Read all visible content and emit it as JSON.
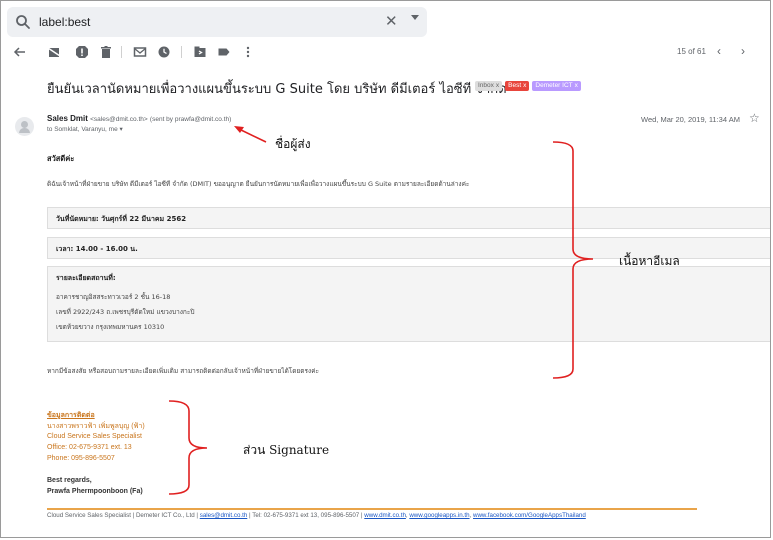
{
  "search": {
    "query": "label:best"
  },
  "toolbar": {
    "count": "15 of 61"
  },
  "email": {
    "subject": "ยืนยันเวลานัดหมายเพื่อวางแผนขึ้นระบบ G Suite โดย บริษัท ดีมีเตอร์ ไอซีที จำกัด",
    "labels": [
      {
        "text": "Inbox",
        "bg": "#dddddd",
        "fg": "#666666"
      },
      {
        "text": "Best",
        "bg": "#e8453c",
        "fg": "#ffffff"
      },
      {
        "text": "Demeter ICT",
        "bg": "#b99aff",
        "fg": "#ffffff"
      }
    ],
    "sender_name": "Sales Dmit",
    "sender_email": "<sales@dmit.co.th>",
    "sent_by": "(sent by prawfa@dmit.co.th)",
    "to": "to Somklat, Varanyu, me",
    "date": "Wed, Mar 20, 2019, 11:34 AM",
    "greeting": "สวัสดีค่ะ",
    "intro": "ดิฉันเจ้าหน้าที่ฝ่ายขาย บริษัท ดีมีเตอร์ ไอซีที จำกัด (DMIT) ขออนุญาต ยืนยันการนัดหมายเพื่อเพื่อวางแผนขึ้นระบบ G Suite ตามรายละเอียดด้านล่างค่ะ",
    "appointment_date": "วันที่นัดหมาย: วันศุกร์ที่ 22 มีนาคม 2562",
    "time": "เวลา: 14.00 - 16.00 น.",
    "location_title": "รายละเอียดสถานที่:",
    "location_lines": [
      "อาคารชาญอิสสระทาวเวอร์ 2 ชั้น 16-18",
      "เลขที่ 2922/243 ถ.เพชรบุรีตัดใหม่ แขวงบางกะปิ",
      "เขตห้วยขวาง กรุงเทพมหานคร 10310"
    ],
    "closing": "หากมีข้อสงสัย หรือสอบถามรายละเอียดเพิ่มเติม สามารถติดต่อกลับเจ้าหน้าที่ฝ่ายขายได้โดยตรงค่ะ"
  },
  "signature": {
    "heading": "ข้อมูลการติดต่อ",
    "name_th": "นางสาวพราวฟ้า เพิ่มพูลบุญ (ฟ้า)",
    "role": "Cloud Service Sales Specialist",
    "office": "Office: 02-675-9371 ext. 13",
    "phone": "Phone: 095-896-5507",
    "regards": "Best regards,",
    "name_en": "Prawfa Phermpoonboon (Fa)",
    "footer_text": "Cloud Service Sales Specialist | Demeter ICT Co., Ltd |",
    "footer_email": "sales@dmit.co.th",
    "footer_tel": "| Tel: 02-675-9371 ext 13, 095-896-5507 |",
    "footer_link1": "www.dmit.co.th",
    "footer_link2": "www.googleapps.in.th",
    "footer_link3": "www.facebook.com/GoogleAppsThailand"
  },
  "annotations": {
    "sender": "ชื่อผู้ส่ง",
    "content": "เนื้อหาอีเมล",
    "signature": "ส่วน Signature"
  }
}
